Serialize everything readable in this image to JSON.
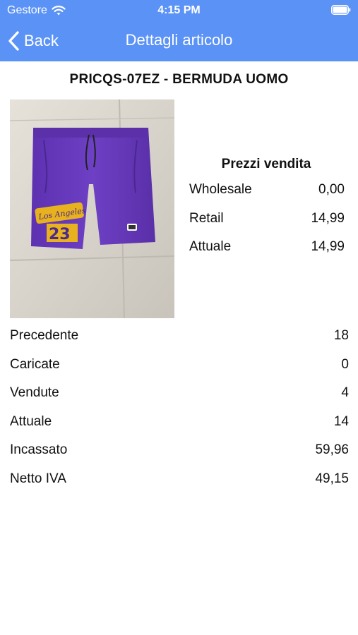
{
  "status_bar": {
    "carrier": "Gestore",
    "time": "4:15 PM"
  },
  "navbar": {
    "back_label": "Back",
    "title": "Dettagli articolo"
  },
  "article": {
    "title": "PRICQS-07EZ - BERMUDA UOMO",
    "image_print_text": "Los Angeles",
    "image_number": "23"
  },
  "prices": {
    "title": "Prezzi vendita",
    "rows": [
      {
        "label": "Wholesale",
        "value": "0,00"
      },
      {
        "label": "Retail",
        "value": "14,99"
      },
      {
        "label": "Attuale",
        "value": "14,99"
      }
    ]
  },
  "stats": [
    {
      "label": "Precedente",
      "value": "18"
    },
    {
      "label": "Caricate",
      "value": "0"
    },
    {
      "label": "Vendute",
      "value": "4"
    },
    {
      "label": "Attuale",
      "value": "14"
    },
    {
      "label": "Incassato",
      "value": "59,96"
    },
    {
      "label": "Netto IVA",
      "value": "49,15"
    }
  ],
  "colors": {
    "navbar": "#5b92f6",
    "text": "#111111",
    "shorts": "#6a3bbf"
  },
  "icons": [
    "wifi-icon",
    "battery-icon",
    "chevron-left-icon"
  ]
}
